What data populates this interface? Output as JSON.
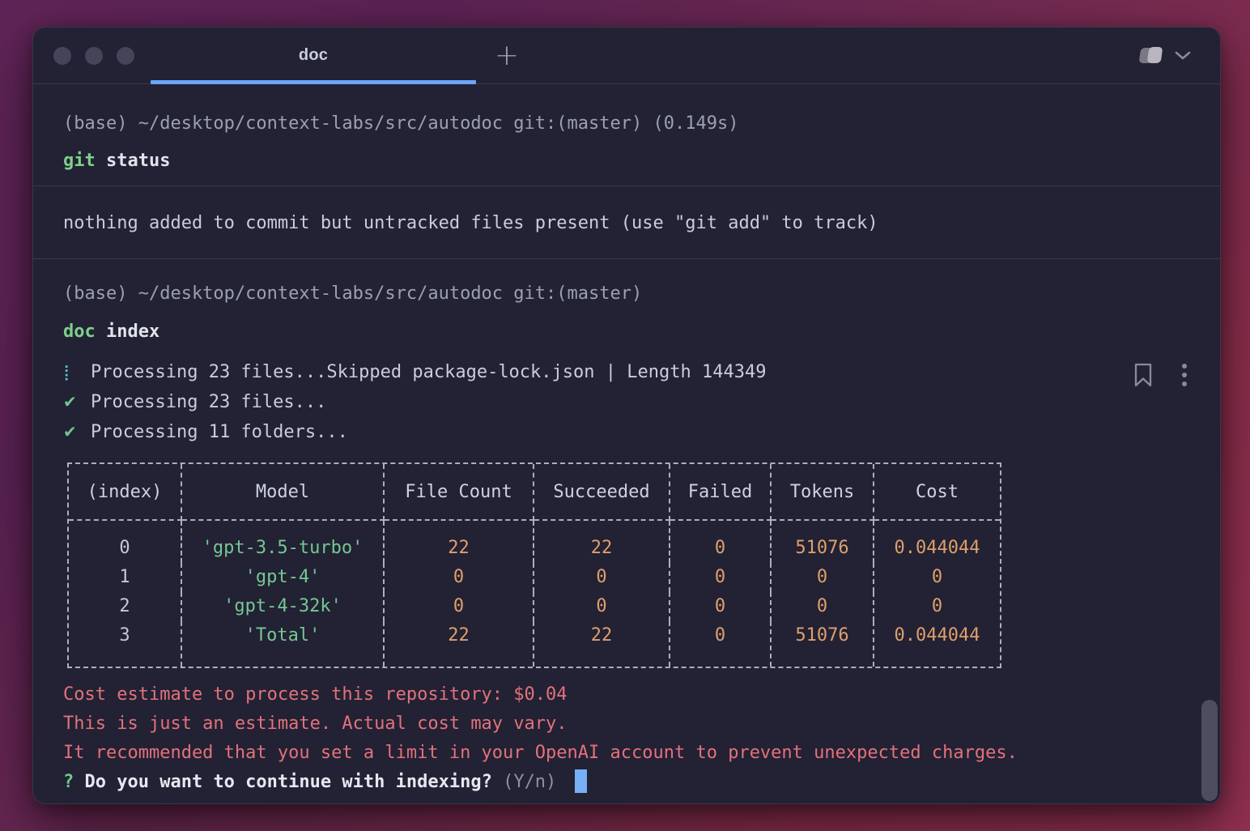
{
  "window": {
    "tab_title": "doc",
    "new_tab_glyph": "+"
  },
  "terminal": {
    "block1": {
      "prompt": "(base) ~/desktop/context-labs/src/autodoc git:(master) (0.149s)",
      "command_keyword": "git",
      "command_args": "status",
      "output": "nothing added to commit but untracked files present (use \"git add\" to track)"
    },
    "block2": {
      "prompt": "(base) ~/desktop/context-labs/src/autodoc git:(master)",
      "command_keyword": "doc",
      "command_args": "index",
      "progress": [
        {
          "icon": "spinner-icon",
          "glyph": "⡇",
          "text": "Processing 23 files...Skipped package-lock.json | Length 144349"
        },
        {
          "icon": "check-icon",
          "glyph": "✔",
          "text": "Processing 23 files..."
        },
        {
          "icon": "check-icon",
          "glyph": "✔",
          "text": "Processing 11 folders..."
        }
      ],
      "table": {
        "headers": [
          "(index)",
          "Model",
          "File Count",
          "Succeeded",
          "Failed",
          "Tokens",
          "Cost"
        ],
        "rows": [
          [
            "0",
            "'gpt-3.5-turbo'",
            "22",
            "22",
            "0",
            "51076",
            "0.044044"
          ],
          [
            "1",
            "'gpt-4'",
            "0",
            "0",
            "0",
            "0",
            "0"
          ],
          [
            "2",
            "'gpt-4-32k'",
            "0",
            "0",
            "0",
            "0",
            "0"
          ],
          [
            "3",
            "'Total'",
            "22",
            "22",
            "0",
            "51076",
            "0.044044"
          ]
        ]
      },
      "warnings": [
        "Cost estimate to process this repository: $0.04",
        "This is just an estimate. Actual cost may vary.",
        "It recommended that you set a limit in your OpenAI account to prevent unexpected charges."
      ],
      "question": {
        "mark": "?",
        "text": "Do you want to continue with indexing?",
        "hint": "(Y/n)"
      }
    }
  },
  "colors": {
    "accent_blue": "#6aa7f8",
    "command_green": "#7dd08c",
    "model_green": "#74c893",
    "number_orange": "#dda06b",
    "warning_red": "#e2727b",
    "spinner_cyan": "#57c3d7",
    "cursor_blue": "#76b1f6",
    "table_border": "#a8b0bd",
    "window_bg": "#232134"
  }
}
